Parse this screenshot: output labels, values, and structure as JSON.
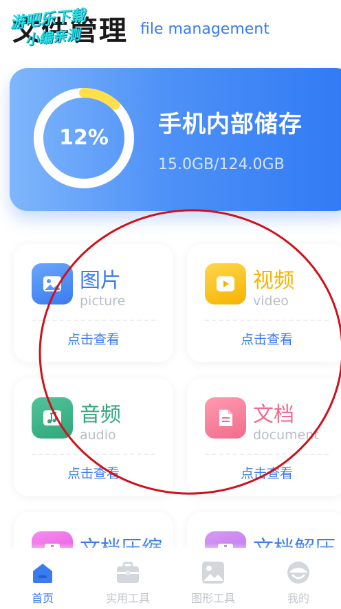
{
  "header": {
    "title": "文件管理",
    "subtitle": "file management",
    "watermark_line1": "游吧乐下载",
    "watermark_line2": "小编亲测"
  },
  "storage": {
    "percent_label": "12%",
    "used_fraction": 0.12,
    "title": "手机内部储存",
    "size": "15.0GB/124.0GB"
  },
  "categories": [
    {
      "cn": "图片",
      "en": "picture",
      "action": "点击查看",
      "color": "#3a7bf0",
      "icon": "image-icon"
    },
    {
      "cn": "视频",
      "en": "video",
      "action": "点击查看",
      "color": "#f5b400",
      "icon": "play-icon"
    },
    {
      "cn": "音频",
      "en": "audio",
      "action": "点击查看",
      "color": "#2fa77b",
      "icon": "music-icon"
    },
    {
      "cn": "文档",
      "en": "document",
      "action": "点击查看",
      "color": "#f06c8c",
      "icon": "document-icon"
    },
    {
      "cn": "文档压缩",
      "en": "",
      "action": "",
      "color": "#e04bd8",
      "icon": "zip-icon"
    },
    {
      "cn": "文档解压",
      "en": "",
      "action": "",
      "color": "#b86ae8",
      "icon": "unzip-icon"
    }
  ],
  "tabbar": {
    "items": [
      {
        "label": "首页",
        "icon": "home-icon",
        "active": true
      },
      {
        "label": "实用工具",
        "icon": "toolbox-icon",
        "active": false
      },
      {
        "label": "图形工具",
        "icon": "image-tool-icon",
        "active": false
      },
      {
        "label": "我的",
        "icon": "profile-icon",
        "active": false
      }
    ]
  },
  "colors": {
    "accent": "#3a7bf0",
    "ring_progress": "#ffe04a",
    "annotation_circle": "#d0101a"
  }
}
